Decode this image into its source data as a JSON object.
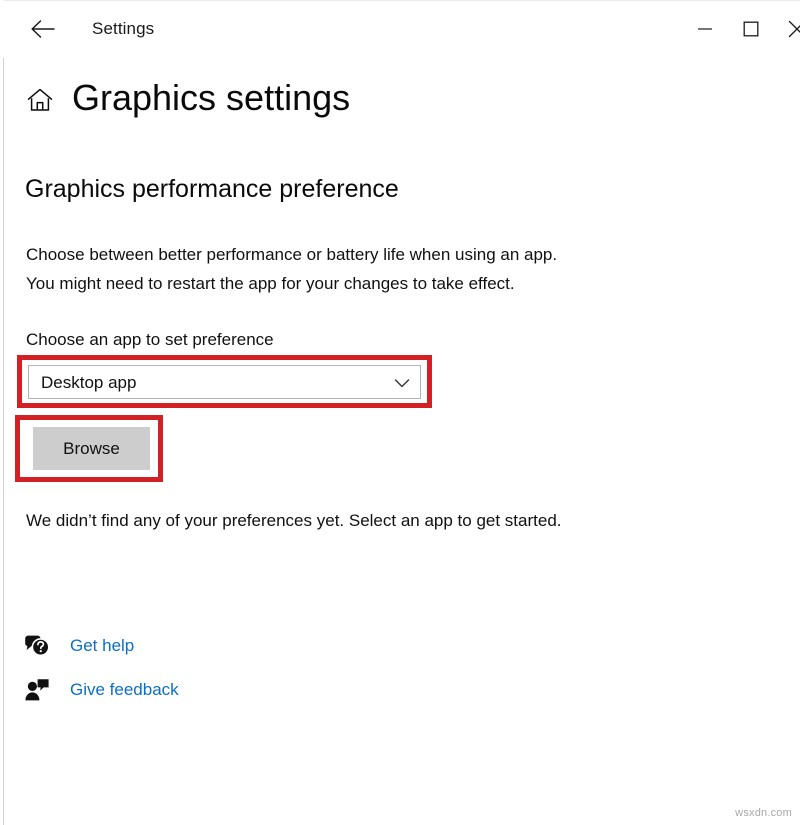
{
  "window": {
    "title": "Settings",
    "back_icon": "arrow-left-icon",
    "minimize_icon": "minimize-icon",
    "maximize_icon": "maximize-icon",
    "close_icon": "close-icon"
  },
  "page": {
    "home_icon": "home-icon",
    "title": "Graphics settings",
    "section_heading": "Graphics performance preference",
    "description_line1": "Choose between better performance or battery life when using an app.",
    "description_line2": "You might need to restart the app for your changes to take effect.",
    "empty_state": "We didn’t find any of your preferences yet. Select an app to get started."
  },
  "app_picker": {
    "label": "Choose an app to set preference",
    "selected_value": "Desktop app",
    "chevron_icon": "chevron-down-icon",
    "browse_label": "Browse"
  },
  "footer": {
    "get_help": {
      "label": "Get help",
      "icon": "help-chat-icon"
    },
    "give_feedback": {
      "label": "Give feedback",
      "icon": "person-feedback-icon"
    }
  },
  "annotations": {
    "highlight_color": "#d32025"
  },
  "watermark": {
    "text": "wsxdn.com"
  }
}
